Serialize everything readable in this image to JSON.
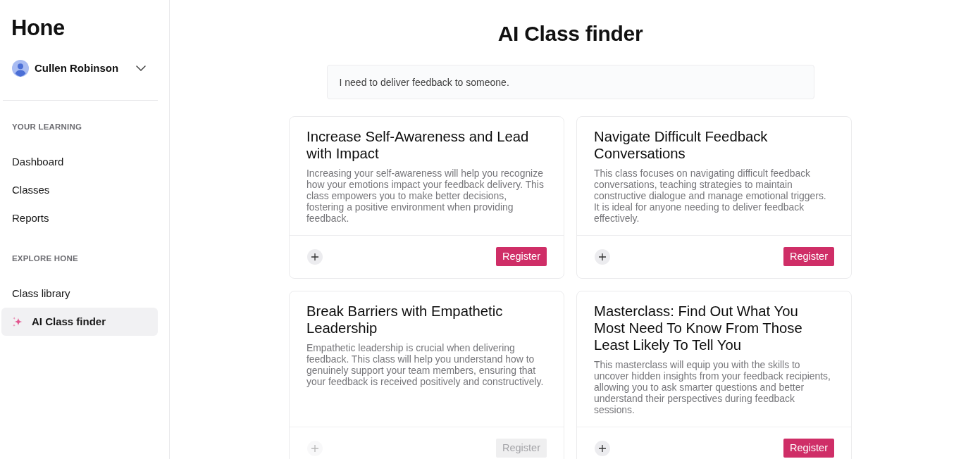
{
  "sidebar": {
    "logo": "Hone",
    "user": {
      "name": "Cullen Robinson"
    },
    "sections": [
      {
        "heading": "YOUR LEARNING",
        "items": [
          {
            "label": "Dashboard",
            "kind": "plain",
            "selected": false
          },
          {
            "label": "Classes",
            "kind": "plain",
            "selected": false
          },
          {
            "label": "Reports",
            "kind": "plain",
            "selected": false
          }
        ]
      },
      {
        "heading": "EXPLORE HONE",
        "items": [
          {
            "label": "Class library",
            "kind": "plain",
            "selected": false
          },
          {
            "label": "AI Class finder",
            "kind": "ai",
            "selected": true
          }
        ]
      }
    ]
  },
  "main": {
    "title": "AI Class finder",
    "query": {
      "value": "I need to deliver feedback to someone."
    },
    "classes": [
      {
        "title": "Increase Self-Awareness and Lead with Impact",
        "description": "Increasing your self-awareness will help you recognize how your emotions impact your feedback delivery. This class empowers you to make better decisions, fostering a positive environment when providing feedback.",
        "register_label": "Register",
        "disabled": false
      },
      {
        "title": "Navigate Difficult Feedback Conversations",
        "description": "This class focuses on navigating difficult feedback conversations, teaching strategies to maintain constructive dialogue and manage emotional triggers. It is ideal for anyone needing to deliver feedback effectively.",
        "register_label": "Register",
        "disabled": false
      },
      {
        "title": "Break Barriers with Empathetic Leadership",
        "description": "Empathetic leadership is crucial when delivering feedback. This class will help you understand how to genuinely support your team members, ensuring that your feedback is received positively and constructively.",
        "register_label": "Register",
        "disabled": true
      },
      {
        "title": "Masterclass: Find Out What You Most Need To Know From Those Least Likely To Tell You",
        "description": "This masterclass will equip you with the skills to uncover hidden insights from your feedback recipients, allowing you to ask smarter questions and better understand their perspectives during feedback sessions.",
        "register_label": "Register",
        "disabled": false
      }
    ]
  }
}
